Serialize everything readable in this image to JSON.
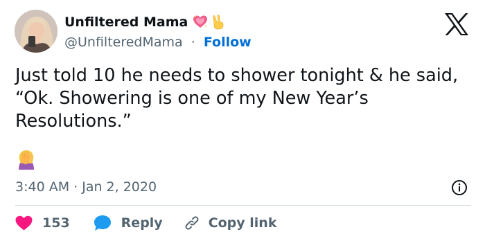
{
  "author": {
    "name": "Unfiltered Mama",
    "handle": "@UnfilteredMama",
    "separator": "·",
    "follow_label": "Follow",
    "name_emojis": [
      "sparkling-heart-emoji",
      "victory-hand-emoji"
    ]
  },
  "tweet": {
    "text": "Just told 10 he needs to shower tonight & he said, “Ok. Showering is one of my New Year’s Resolutions.”",
    "trailing_emoji": "woman-facepalming-emoji",
    "timestamp": "3:40 AM · Jan 2, 2020"
  },
  "actions": {
    "like_count": "153",
    "reply_label": "Reply",
    "copy_label": "Copy link"
  },
  "colors": {
    "like": "#f91880",
    "reply": "#1d9bf0",
    "follow": "#006fd6",
    "muted": "#536471",
    "text": "#0f1419",
    "divider": "#cfd9de"
  },
  "icons": [
    "x-logo-icon",
    "info-icon",
    "heart-icon",
    "reply-bubble-icon",
    "link-icon"
  ]
}
